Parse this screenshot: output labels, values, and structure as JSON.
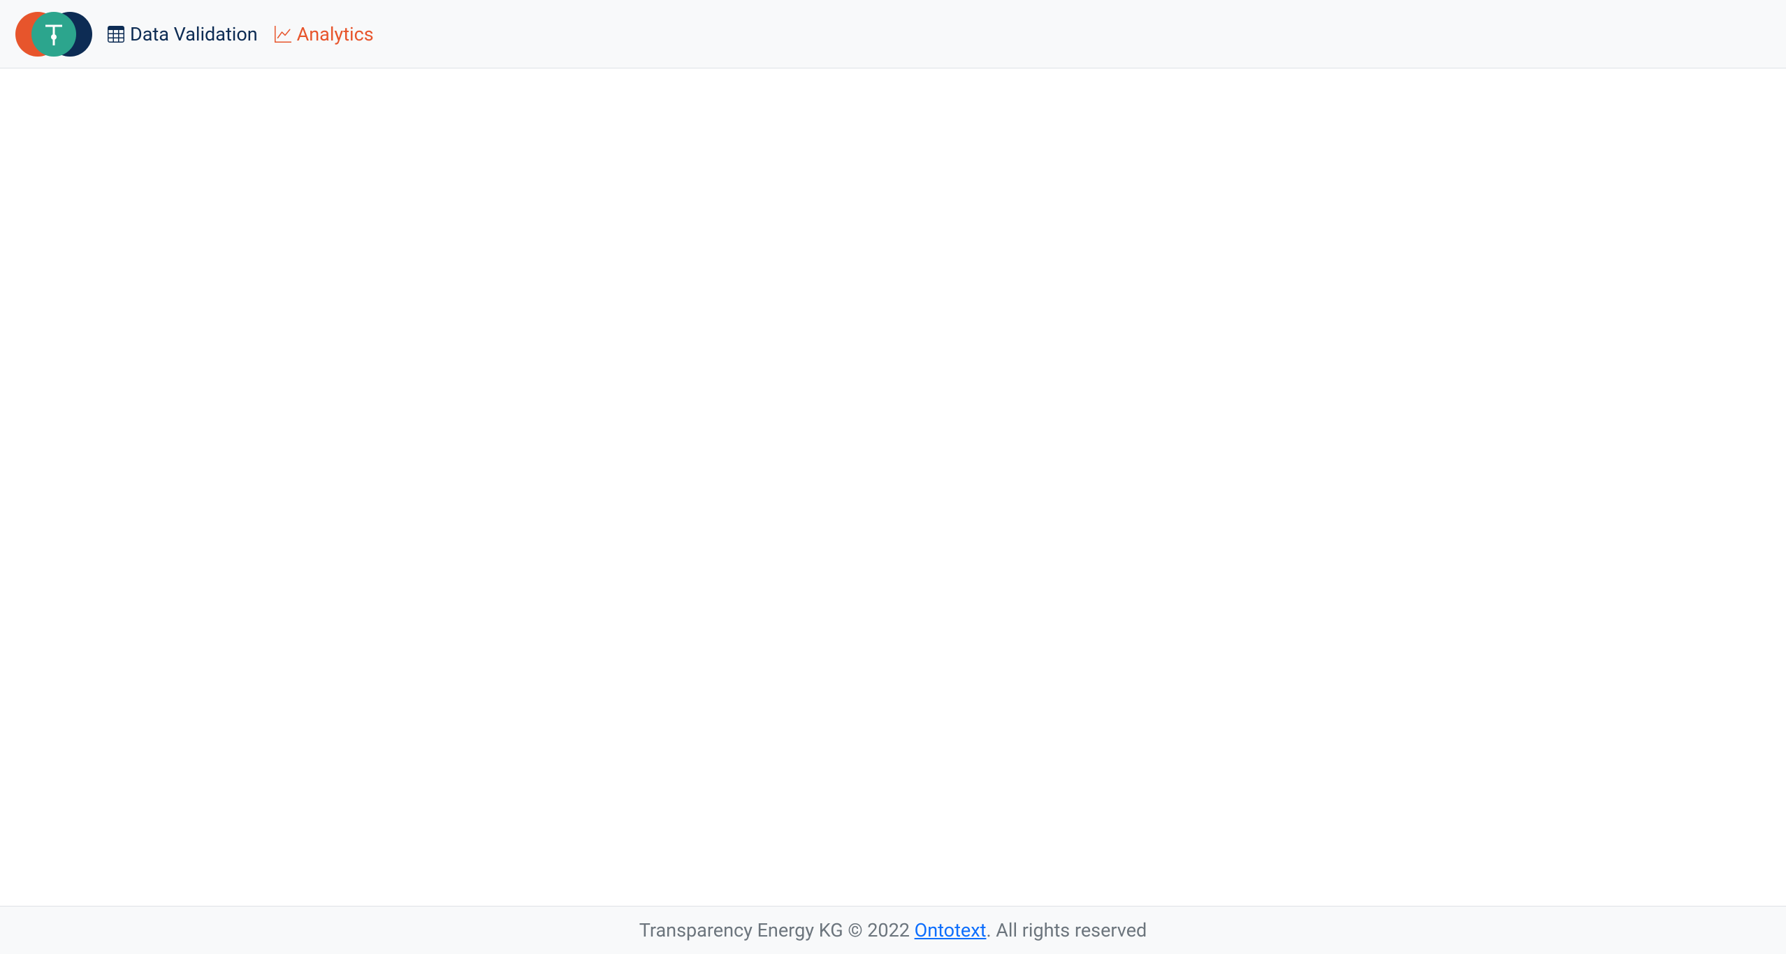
{
  "navbar": {
    "links": [
      {
        "label": "Data Validation"
      },
      {
        "label": "Analytics"
      }
    ]
  },
  "footer": {
    "prefix": "Transparency Energy KG © 2022 ",
    "link_text": "Ontotext",
    "suffix": ". All rights reserved"
  }
}
